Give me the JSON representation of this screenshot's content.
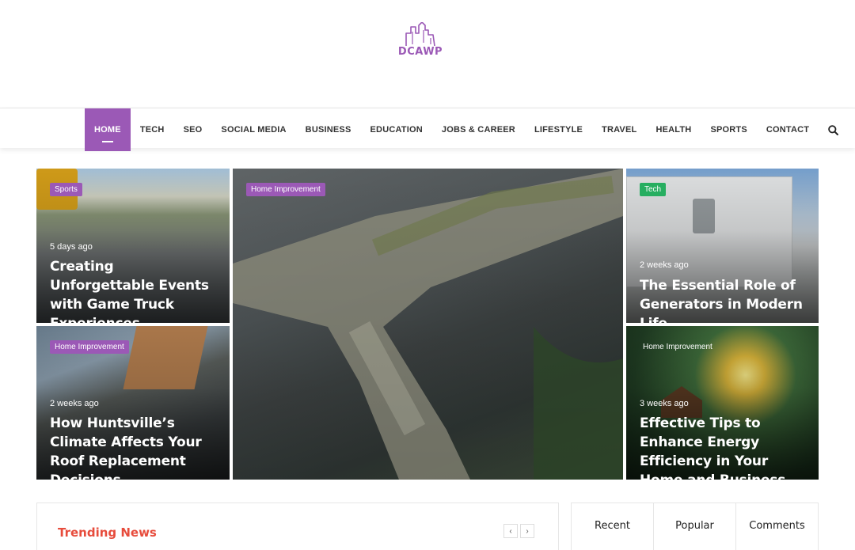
{
  "header": {
    "logo_text": "DCAWP",
    "accent_color": "#9b59b6"
  },
  "nav": {
    "items": [
      {
        "label": "HOME",
        "active": true
      },
      {
        "label": "TECH"
      },
      {
        "label": "SEO"
      },
      {
        "label": "SOCIAL MEDIA"
      },
      {
        "label": "BUSINESS"
      },
      {
        "label": "EDUCATION"
      },
      {
        "label": "JOBS & CAREER"
      },
      {
        "label": "LIFESTYLE"
      },
      {
        "label": "TRAVEL"
      },
      {
        "label": "HEALTH"
      },
      {
        "label": "SPORTS"
      },
      {
        "label": "CONTACT"
      }
    ],
    "search_icon": "search-icon"
  },
  "featured": {
    "card1": {
      "category": "Sports",
      "time": "5 days ago",
      "title": "Creating Unforgettable Events with Game Truck Experiences"
    },
    "card2": {
      "category": "Home Improvement",
      "time": "2 weeks ago",
      "title": "How Huntsville’s Climate Affects Your Roof Replacement Decisions"
    },
    "card3": {
      "category": "Home Improvement"
    },
    "card4": {
      "category": "Tech",
      "time": "2 weeks ago",
      "title": "The Essential Role of Generators in Modern Life"
    },
    "card5": {
      "category": "Home Improvement",
      "time": "3 weeks ago",
      "title": "Effective Tips to Enhance Energy Efficiency in Your Home and Business"
    }
  },
  "trending": {
    "title": "Trending News",
    "prev": "‹",
    "next": "›"
  },
  "sidebar_tabs": {
    "recent": "Recent",
    "popular": "Popular",
    "comments": "Comments"
  }
}
